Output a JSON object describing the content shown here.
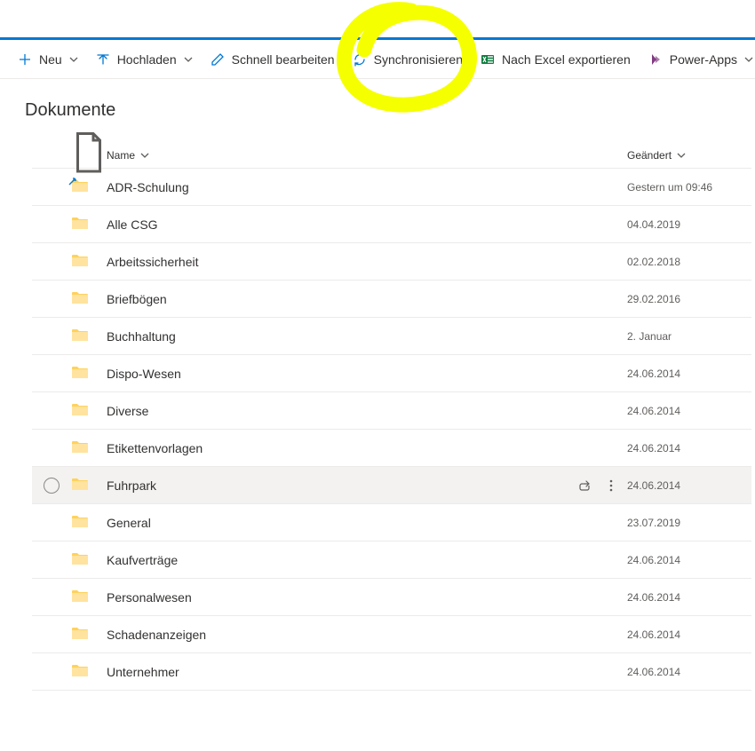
{
  "toolbar": {
    "new": "Neu",
    "upload": "Hochladen",
    "quick_edit": "Schnell bearbeiten",
    "sync": "Synchronisieren",
    "export_excel": "Nach Excel exportieren",
    "power_apps": "Power-Apps"
  },
  "page": {
    "title": "Dokumente"
  },
  "columns": {
    "name": "Name",
    "modified": "Geändert"
  },
  "rows": [
    {
      "name": "ADR-Schulung",
      "modified": "Gestern um 09:46",
      "shortcut": true
    },
    {
      "name": "Alle CSG",
      "modified": "04.04.2019"
    },
    {
      "name": "Arbeitssicherheit",
      "modified": "02.02.2018"
    },
    {
      "name": "Briefbögen",
      "modified": "29.02.2016"
    },
    {
      "name": "Buchhaltung",
      "modified": "2. Januar"
    },
    {
      "name": "Dispo-Wesen",
      "modified": "24.06.2014"
    },
    {
      "name": "Diverse",
      "modified": "24.06.2014"
    },
    {
      "name": "Etikettenvorlagen",
      "modified": "24.06.2014"
    },
    {
      "name": "Fuhrpark",
      "modified": "24.06.2014",
      "hovered": true
    },
    {
      "name": "General",
      "modified": "23.07.2019"
    },
    {
      "name": "Kaufverträge",
      "modified": "24.06.2014"
    },
    {
      "name": "Personalwesen",
      "modified": "24.06.2014"
    },
    {
      "name": "Schadenanzeigen",
      "modified": "24.06.2014"
    },
    {
      "name": "Unternehmer",
      "modified": "24.06.2014"
    }
  ]
}
